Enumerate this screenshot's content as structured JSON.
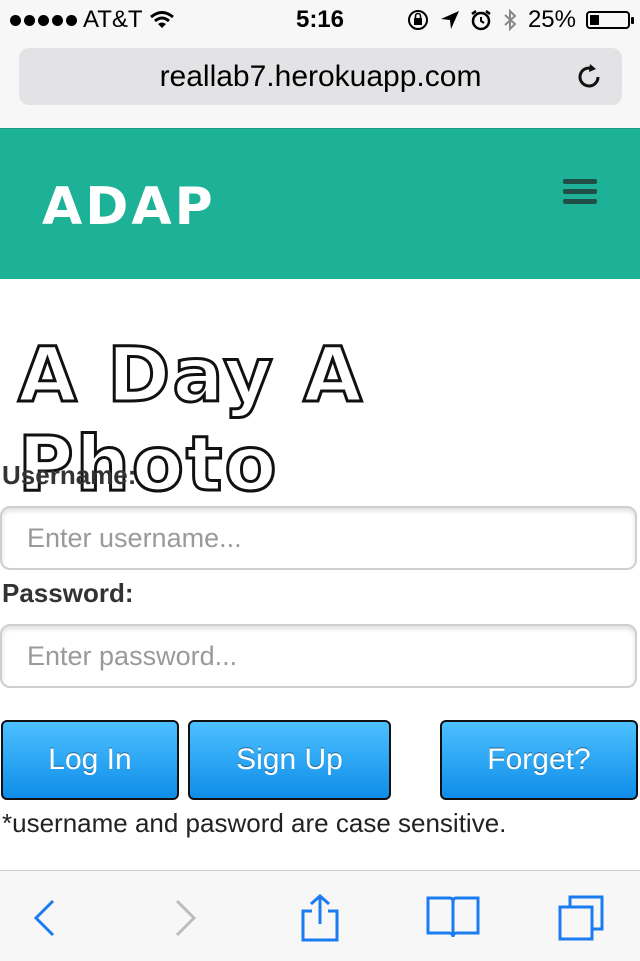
{
  "status_bar": {
    "carrier": "AT&T",
    "time": "5:16",
    "battery": "25%",
    "battery_level": 0.25
  },
  "browser": {
    "url": "reallab7.herokuapp.com"
  },
  "header": {
    "brand": "ADAP"
  },
  "hero": {
    "title": "A Day A Photo"
  },
  "form": {
    "username_label": "Username:",
    "username_placeholder": "Enter username...",
    "password_label": "Password:",
    "password_placeholder": "Enter password...",
    "login_label": "Log In",
    "signup_label": "Sign Up",
    "forget_label": "Forget?",
    "note": "*username and pasword are case sensitive."
  },
  "colors": {
    "header_bg": "#1db198",
    "button_top": "#4cc0ff",
    "button_bottom": "#0f8de8",
    "ios_blue": "#1a7cf0"
  },
  "icons": {
    "back": "back-chevron-icon",
    "forward": "forward-chevron-icon",
    "share": "share-icon",
    "bookmarks": "bookmarks-icon",
    "tabs": "tabs-icon",
    "reload": "reload-icon",
    "menu": "hamburger-icon"
  }
}
